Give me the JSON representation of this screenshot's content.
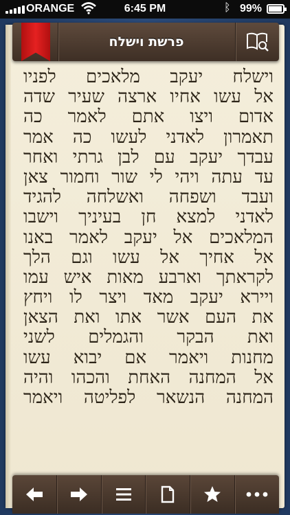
{
  "status_bar": {
    "carrier": "ORANGE",
    "time": "6:45 PM",
    "battery": "99%"
  },
  "header": {
    "title": "פרשת וישלח",
    "book_icon": "book-search-icon",
    "bookmark_icon": "red-ribbon-bookmark-icon"
  },
  "text": {
    "lines": [
      "וישלח יעקב מלאכים לפניו",
      "אל עשו אחיו ארצה שעיר שדה",
      "אדום ויצו אתם לאמר כה",
      "תאמרון לאדני לעשו כה אמר",
      "עבדך יעקב עם לבן גרתי ואחר",
      "עד עתה ויהי לי שור וחמור צאן",
      "ועבד ושפחה ואשלחה להגיד",
      "לאדני למצא חן בעיניך וישבו",
      "המלאכים אל יעקב לאמר באנו",
      "אל אחיך אל עשו וגם הלך",
      "לקראתך וארבע מאות איש עמו",
      "ויירא יעקב מאד ויצר לו ויחץ",
      "את העם אשר אתו ואת הצאן",
      "ואת הבקר והגמלים לשני",
      "מחנות ויאמר אם יבוא עשו",
      "אל המחנה האחת והכהו והיה",
      "המחנה הנשאר לפליטה ויאמר"
    ]
  },
  "toolbar": {
    "buttons": [
      {
        "icon": "arrow-left-icon"
      },
      {
        "icon": "arrow-right-icon"
      },
      {
        "icon": "list-icon"
      },
      {
        "icon": "page-icon"
      },
      {
        "icon": "star-icon"
      },
      {
        "icon": "more-icon"
      }
    ]
  },
  "colors": {
    "parchment": "#f1e9d4",
    "leather": "#4b3a2e",
    "ribbon": "#d41b1b",
    "cover": "#24416b"
  }
}
